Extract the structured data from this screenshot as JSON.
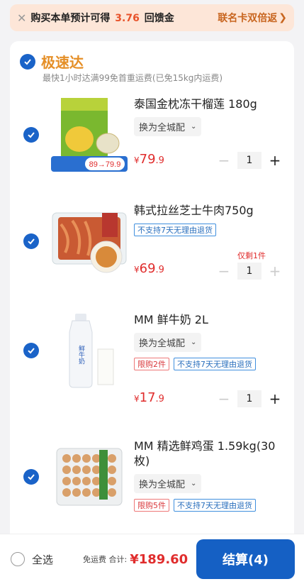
{
  "promo": {
    "prefix": "购买本单预计可得",
    "amount": "3.76",
    "suffix": "回馈金",
    "cobrand": "联名卡双倍返"
  },
  "store": {
    "name": "极速达",
    "subtitle": "最快1小时达满99免首重运费(已免15kg内运费)"
  },
  "items": [
    {
      "title": "泰国金枕冻干榴莲 180g",
      "spec": "换为全城配",
      "price_int": "79",
      "price_dec": ".9",
      "qty": "1",
      "image_badge": "89→79.9"
    },
    {
      "title": "韩式拉丝芝士牛肉750g",
      "tags": [
        "不支持7天无理由退货"
      ],
      "stock_note": "仅剩1件",
      "price_int": "69",
      "price_dec": ".9",
      "qty": "1"
    },
    {
      "title": "MM 鲜牛奶 2L",
      "spec": "换为全城配",
      "tags": [
        "限购2件",
        "不支持7天无理由退货"
      ],
      "price_int": "17",
      "price_dec": ".9",
      "qty": "1"
    },
    {
      "title": "MM 精选鲜鸡蛋 1.59kg(30枚)",
      "spec": "换为全城配",
      "tags": [
        "限购5件",
        "不支持7天无理由退货"
      ]
    }
  ],
  "currency": "¥",
  "bottom": {
    "select_all": "全选",
    "shipping_note": "免运费 合计:",
    "total": "¥189.60",
    "checkout": "结算(4)"
  }
}
